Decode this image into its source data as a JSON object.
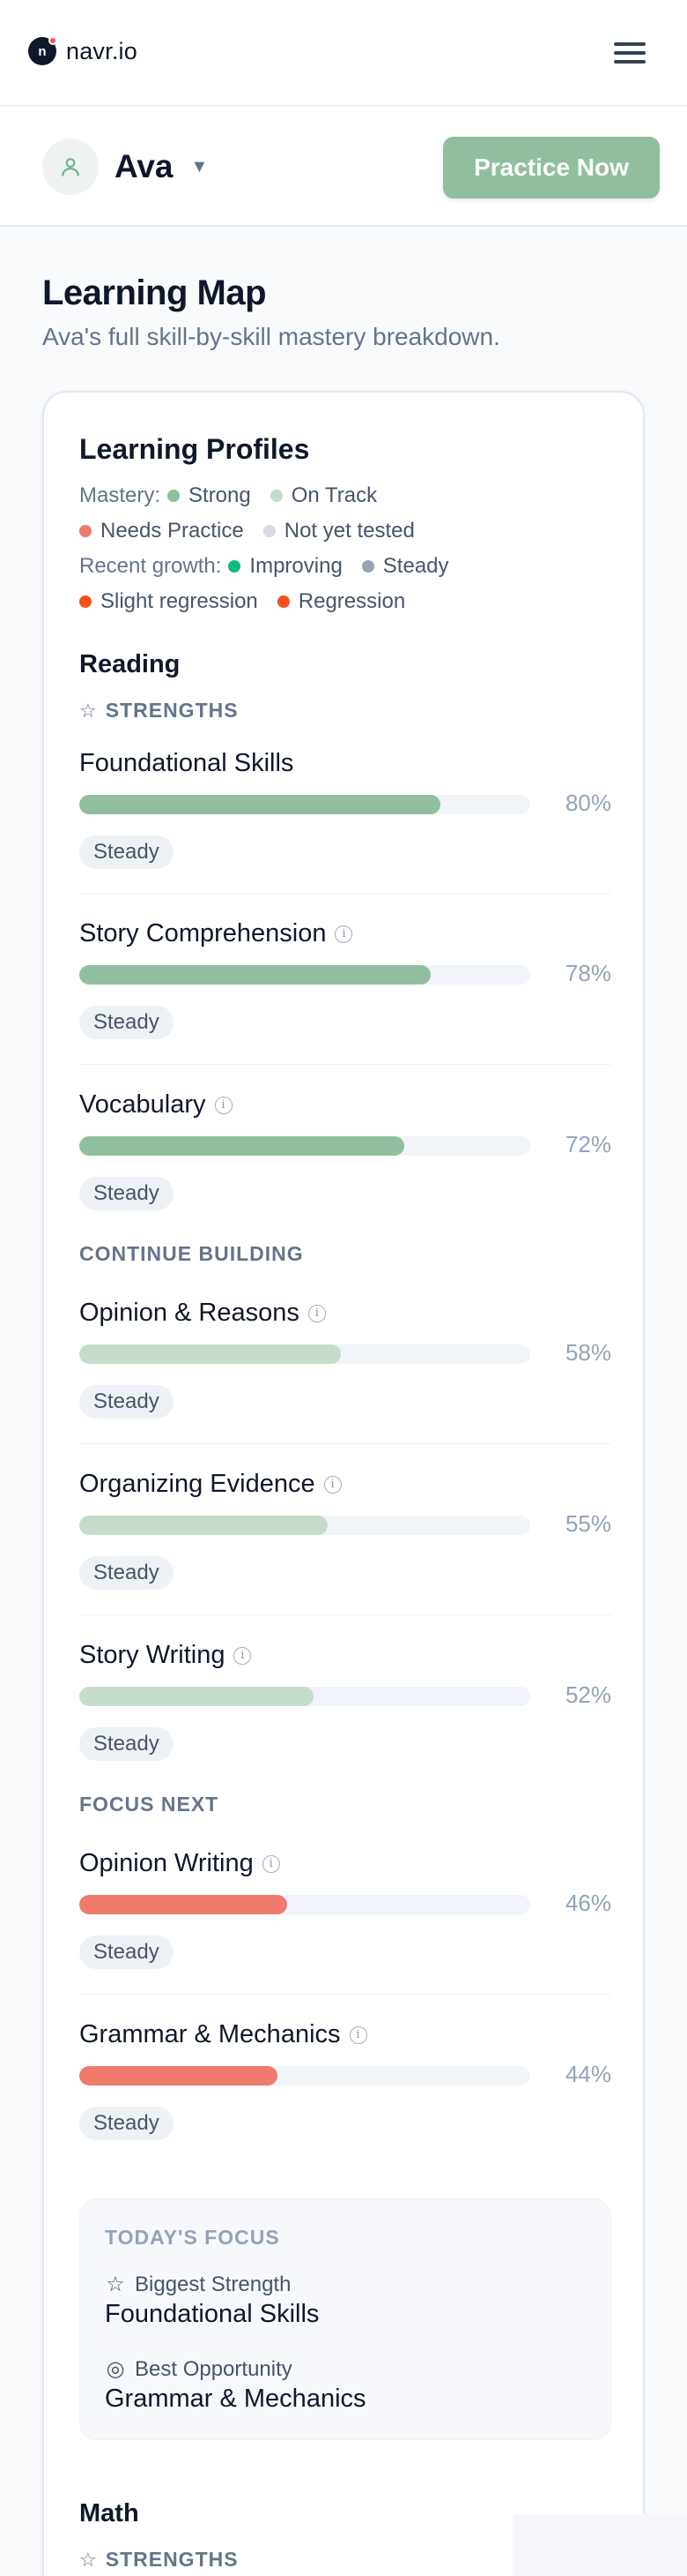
{
  "app": {
    "logo_letter": "n",
    "name": "navr.io"
  },
  "student": {
    "name": "Ava",
    "practice_label": "Practice Now"
  },
  "page": {
    "title": "Learning Map",
    "subtitle": "Ava's full skill-by-skill mastery breakdown."
  },
  "profiles": {
    "title": "Learning Profiles",
    "mastery_label": "Mastery:",
    "mastery": [
      {
        "label": "Strong",
        "color": "#8fbf9f"
      },
      {
        "label": "On Track",
        "color": "#c5dccb"
      },
      {
        "label": "Needs Practice",
        "color": "#f07a6c"
      },
      {
        "label": "Not yet tested",
        "color": "#d5dbe3"
      }
    ],
    "growth_label": "Recent growth:",
    "growth": [
      {
        "label": "Improving",
        "color": "#10b981"
      },
      {
        "label": "Steady",
        "color": "#94a3b8"
      },
      {
        "label": "Slight regression",
        "color": "#f4511e"
      },
      {
        "label": "Regression",
        "color": "#f4511e"
      }
    ]
  },
  "reading": {
    "subject": "Reading",
    "strengths_label": "STRENGTHS",
    "continue_label": "CONTINUE BUILDING",
    "focus_label": "FOCUS NEXT",
    "skills": [
      {
        "name": "Foundational Skills",
        "pct": 80,
        "pct_label": "80%",
        "status": "Steady",
        "level": "strong",
        "info": false
      },
      {
        "name": "Story Comprehension",
        "pct": 78,
        "pct_label": "78%",
        "status": "Steady",
        "level": "strong",
        "info": true
      },
      {
        "name": "Vocabulary",
        "pct": 72,
        "pct_label": "72%",
        "status": "Steady",
        "level": "strong",
        "info": true
      },
      {
        "name": "Opinion & Reasons",
        "pct": 58,
        "pct_label": "58%",
        "status": "Steady",
        "level": "on-track",
        "info": true
      },
      {
        "name": "Organizing Evidence",
        "pct": 55,
        "pct_label": "55%",
        "status": "Steady",
        "level": "on-track",
        "info": true
      },
      {
        "name": "Story Writing",
        "pct": 52,
        "pct_label": "52%",
        "status": "Steady",
        "level": "on-track",
        "info": true
      },
      {
        "name": "Opinion Writing",
        "pct": 46,
        "pct_label": "46%",
        "status": "Steady",
        "level": "needs-practice",
        "info": true
      },
      {
        "name": "Grammar & Mechanics",
        "pct": 44,
        "pct_label": "44%",
        "status": "Steady",
        "level": "needs-practice",
        "info": true
      }
    ]
  },
  "colors": {
    "strong": "#8fbf9f",
    "on-track": "#c5dccb",
    "needs-practice": "#f07a6c"
  },
  "todays_focus": {
    "title": "TODAY'S FOCUS",
    "strength_label": "Biggest Strength",
    "strength_value": "Foundational Skills",
    "opportunity_label": "Best Opportunity",
    "opportunity_value": "Grammar & Mechanics"
  },
  "math": {
    "subject": "Math",
    "strengths_label": "STRENGTHS"
  }
}
